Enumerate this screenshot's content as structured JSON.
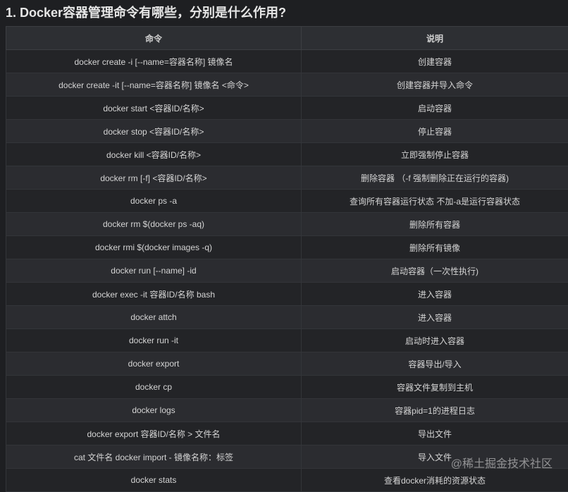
{
  "heading": "1. Docker容器管理命令有哪些，分别是什么作用?",
  "table": {
    "headers": [
      "命令",
      "说明"
    ],
    "rows": [
      [
        "docker create -i [--name=容器名称] 镜像名",
        "创建容器"
      ],
      [
        "docker create -it [--name=容器名称] 镜像名 <命令>",
        "创建容器并导入命令"
      ],
      [
        "docker start <容器ID/名称>",
        "启动容器"
      ],
      [
        "docker stop <容器ID/名称>",
        "停止容器"
      ],
      [
        "docker kill <容器ID/名称>",
        "立即强制停止容器"
      ],
      [
        "docker rm [-f] <容器ID/名称>",
        "删除容器 （-f 强制删除正在运行的容器)"
      ],
      [
        "docker ps -a",
        "查询所有容器运行状态 不加-a是运行容器状态"
      ],
      [
        "docker rm $(docker ps -aq)",
        "删除所有容器"
      ],
      [
        "docker rmi $(docker images -q)",
        "删除所有镜像"
      ],
      [
        "docker run [--name] -id",
        "启动容器（一次性执行)"
      ],
      [
        "docker exec -it 容器ID/名称 bash",
        "进入容器"
      ],
      [
        "docker attch",
        "进入容器"
      ],
      [
        "docker run -it",
        "启动时进入容器"
      ],
      [
        "docker export",
        "容器导出/导入"
      ],
      [
        "docker cp",
        "容器文件复制到主机"
      ],
      [
        "docker logs",
        "容器pid=1的进程日志"
      ],
      [
        "docker export 容器ID/名称 > 文件名",
        "导出文件"
      ],
      [
        "cat 文件名 docker import - 镜像名称：标签",
        "导入文件"
      ],
      [
        "docker stats",
        "查看docker消耗的资源状态"
      ]
    ]
  },
  "watermark": "@稀土掘金技术社区"
}
